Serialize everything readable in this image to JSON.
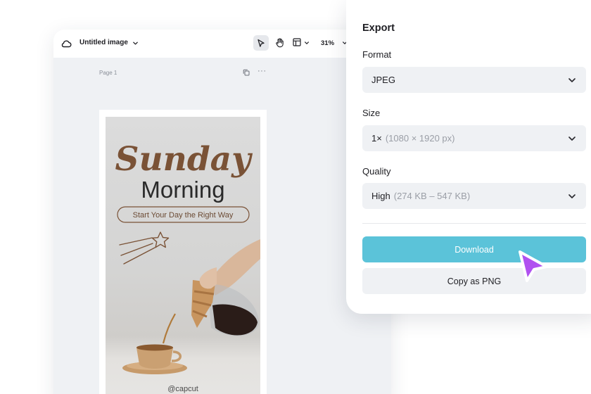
{
  "editor": {
    "title": "Untitled image",
    "zoom": "31%",
    "page_label": "Page 1",
    "more_glyph": "···",
    "icons": [
      "cloud-icon",
      "chevron-down-icon",
      "pointer-icon",
      "hand-icon",
      "layout-icon",
      "copy-icon",
      "more-icon"
    ]
  },
  "poster": {
    "headline_script": "Sunday",
    "headline": "Morning",
    "tagline": "Start Your Day the Right Way",
    "handle": "@capcut",
    "colors": {
      "script": "#7a5236",
      "headline": "#2a2a2a",
      "pill_border": "#7a5236"
    }
  },
  "export": {
    "title": "Export",
    "format": {
      "label": "Format",
      "value": "JPEG"
    },
    "size": {
      "label": "Size",
      "value": "1×",
      "detail": "(1080 × 1920 px)"
    },
    "quality": {
      "label": "Quality",
      "value": "High",
      "detail": "(274 KB – 547 KB)"
    },
    "download_label": "Download",
    "copy_label": "Copy as PNG",
    "colors": {
      "download_bg": "#5bc3d9",
      "cursor": "#b051f0"
    }
  }
}
